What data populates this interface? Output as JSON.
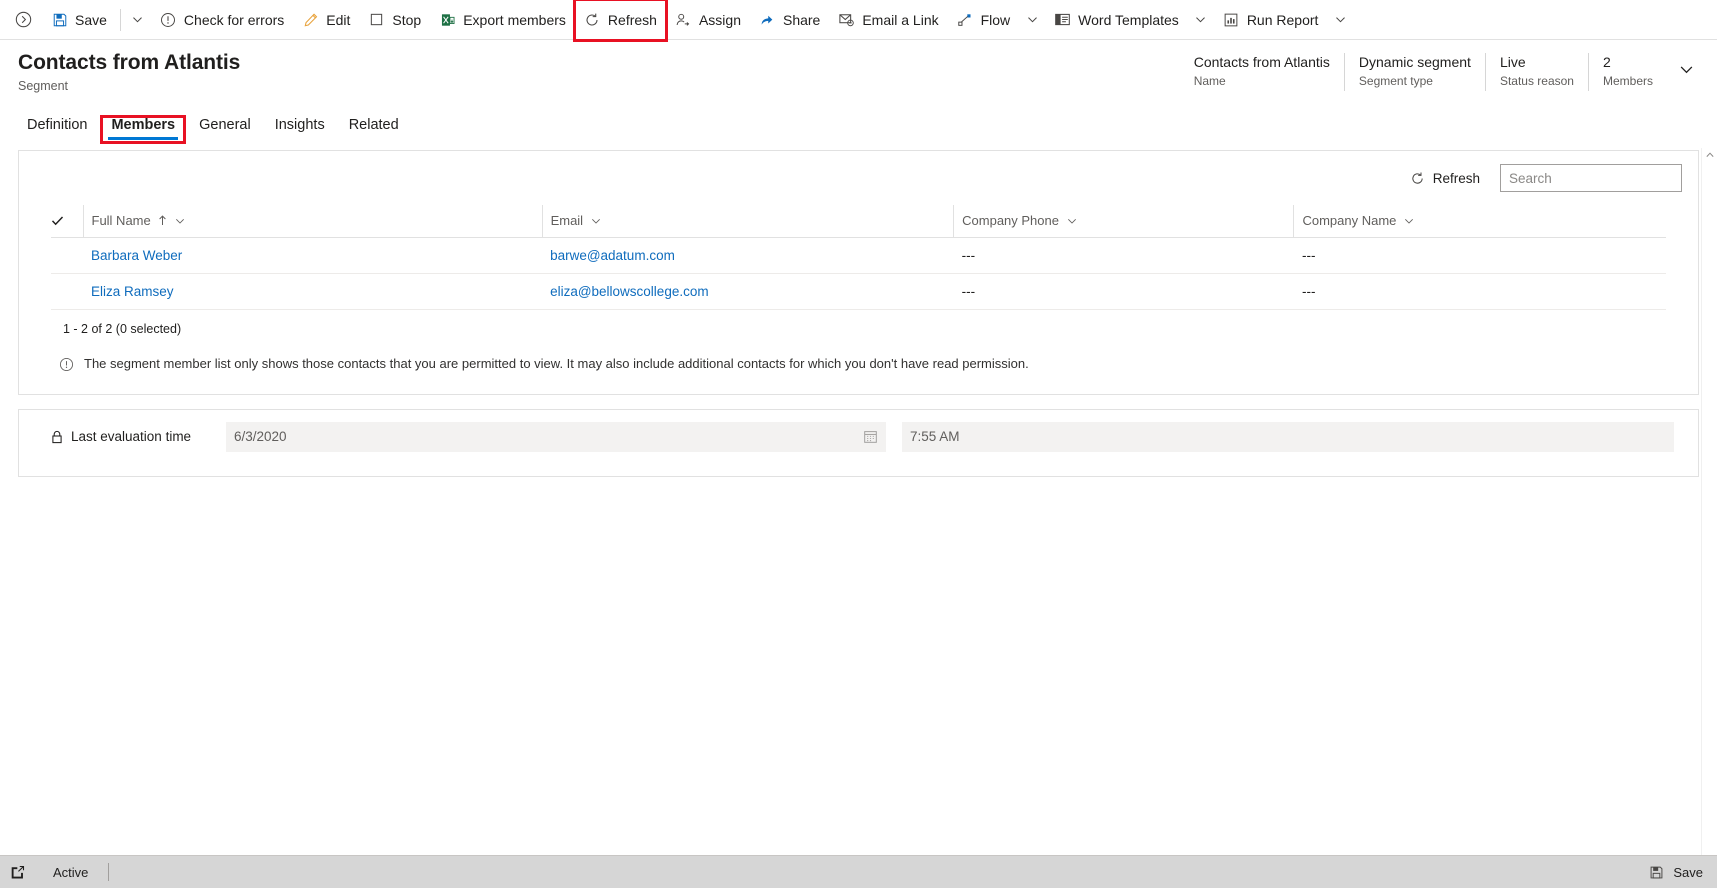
{
  "commandbar": {
    "expand_icon": "chevron-right-circle-icon",
    "items": [
      {
        "id": "save",
        "label": "Save",
        "icon": "save-icon",
        "caret": true
      },
      {
        "id": "check-for-errors",
        "label": "Check for errors",
        "icon": "alert-circle-icon",
        "caret": false
      },
      {
        "id": "edit",
        "label": "Edit",
        "icon": "pencil-icon",
        "caret": false
      },
      {
        "id": "stop",
        "label": "Stop",
        "icon": "stop-square-icon",
        "caret": false
      },
      {
        "id": "export-members",
        "label": "Export members",
        "icon": "excel-icon",
        "caret": false
      },
      {
        "id": "refresh",
        "label": "Refresh",
        "icon": "refresh-icon",
        "caret": false,
        "highlighted": true
      },
      {
        "id": "assign",
        "label": "Assign",
        "icon": "assign-person-icon",
        "caret": false
      },
      {
        "id": "share",
        "label": "Share",
        "icon": "share-icon",
        "caret": false
      },
      {
        "id": "email-a-link",
        "label": "Email a Link",
        "icon": "email-link-icon",
        "caret": false
      },
      {
        "id": "flow",
        "label": "Flow",
        "icon": "flow-icon",
        "caret": true
      },
      {
        "id": "word-templates",
        "label": "Word Templates",
        "icon": "word-template-icon",
        "caret": true
      },
      {
        "id": "run-report",
        "label": "Run Report",
        "icon": "report-icon",
        "caret": true
      }
    ]
  },
  "header": {
    "title": "Contacts from Atlantis",
    "subtitle": "Segment",
    "fields": [
      {
        "value": "Contacts from Atlantis",
        "label": "Name"
      },
      {
        "value": "Dynamic segment",
        "label": "Segment type"
      },
      {
        "value": "Live",
        "label": "Status reason"
      },
      {
        "value": "2",
        "label": "Members"
      }
    ],
    "chevron_icon": "chevron-down-icon"
  },
  "tabs": [
    {
      "label": "Definition",
      "active": false
    },
    {
      "label": "Members",
      "active": true,
      "highlighted": true
    },
    {
      "label": "General",
      "active": false
    },
    {
      "label": "Insights",
      "active": false
    },
    {
      "label": "Related",
      "active": false
    }
  ],
  "grid": {
    "refresh_label": "Refresh",
    "refresh_icon": "refresh-icon",
    "search_placeholder": "Search",
    "search_value": "",
    "search_icon": "magnifier-icon",
    "select_all_icon": "checkmark-icon",
    "columns": [
      {
        "label": "Full Name",
        "sorted": "asc",
        "sort_icon": "arrow-up-icon"
      },
      {
        "label": "Email",
        "sorted": ""
      },
      {
        "label": "Company Phone",
        "sorted": ""
      },
      {
        "label": "Company Name",
        "sorted": ""
      }
    ],
    "rows": [
      {
        "full_name": "Barbara Weber",
        "email": "barwe@adatum.com",
        "company_phone": "---",
        "company_name": "---"
      },
      {
        "full_name": "Eliza Ramsey",
        "email": "eliza@bellowscollege.com",
        "company_phone": "---",
        "company_name": "---"
      }
    ],
    "count_text": "1 - 2 of 2 (0 selected)",
    "note_icon": "info-circle-icon",
    "note_text": "The segment member list only shows those contacts that you are permitted to view. It may also include additional contacts for which you don't have read permission."
  },
  "evaluation": {
    "lock_icon": "lock-icon",
    "label": "Last evaluation time",
    "date_value": "6/3/2020",
    "calendar_icon": "calendar-icon",
    "time_value": "7:55 AM"
  },
  "statusbar": {
    "popout_icon": "popout-icon",
    "state_label": "Active",
    "save_icon": "save-icon",
    "save_label": "Save"
  },
  "colors": {
    "accent": "#0078d4",
    "link": "#0f6cbd",
    "highlight": "#e81123",
    "text": "#201f1e",
    "muted": "#605e5c",
    "statusbar_bg": "#d6d6d6"
  }
}
